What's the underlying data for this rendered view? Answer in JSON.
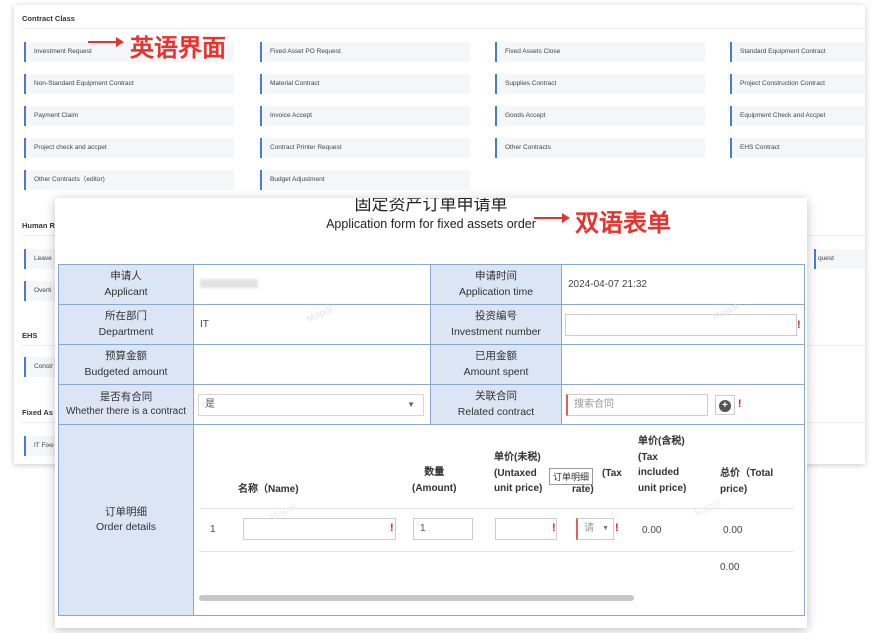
{
  "english_ui": {
    "annotation": "英语界面",
    "contract_class_title": "Contract Class",
    "contract_items": [
      "Investment Request",
      "Fixed Asset PO Request",
      "Fixed Assets Close",
      "Standard Equipment Contract",
      "Non-Standard Equipment Contract",
      "Material Contract",
      "Supplies Contract",
      "Project Construction Contract",
      "Payment Claim",
      "Invoice Accept",
      "Goods Accept",
      "Equipment Check and Accpet",
      "Project check and accpet",
      "Contract Printer Request",
      "Other Contracts",
      "EHS Contract",
      "Other Contracts（editor)",
      "Budget Adjustment"
    ],
    "human_title": "Human R",
    "human_items": [
      "Leave",
      "Overti"
    ],
    "human_right_item": "quest",
    "ehs_title": "EHS",
    "ehs_items": [
      "Constr"
    ],
    "fixed_title": "Fixed As",
    "fixed_items": [
      "IT Fixe"
    ]
  },
  "form": {
    "annotation": "双语表单",
    "title_cn": "固定资产订单申请单",
    "title_en": "Application form for fixed assets order",
    "watermark": "Mapol",
    "labels": {
      "applicant_cn": "申请人",
      "applicant_en": "Applicant",
      "app_time_cn": "申请时间",
      "app_time_en": "Application time",
      "dept_cn": "所在部门",
      "dept_en": "Department",
      "inv_no_cn": "投资编号",
      "inv_no_en": "Investment number",
      "budget_cn": "预算金额",
      "budget_en": "Budgeted amount",
      "spent_cn": "已用金额",
      "spent_en": "Amount spent",
      "has_contract_cn": "是否有合同",
      "has_contract_en": "Whether there is a contract",
      "related_cn": "关联合同",
      "related_en": "Related contract",
      "details_cn": "订单明细",
      "details_en": "Order details"
    },
    "values": {
      "application_time": "2024-04-07 21:32",
      "department": "IT",
      "has_contract": "是",
      "related_placeholder": "搜索合同"
    },
    "details": {
      "name_hdr": "名称（Name)",
      "qty_hdr_cn": "数量",
      "qty_hdr_en": "(Amount)",
      "untaxed_hdr_1": "单价(未税)",
      "untaxed_hdr_2": "(Untaxed",
      "untaxed_hdr_3": "unit price)",
      "tax_hdr_1": "(Tax",
      "tax_hdr_2": "rate)",
      "taxed_hdr_1": "单价(含税)",
      "taxed_hdr_2": "(Tax",
      "taxed_hdr_3": "included",
      "taxed_hdr_4": "unit price)",
      "total_hdr_1": "总价（Total",
      "total_hdr_2": "price)",
      "tooltip": "订单明细",
      "row_no": "1",
      "qty_value": "1",
      "tax_placeholder": "请",
      "taxed_value": "0.00",
      "total_value": "0.00",
      "sum_total": "0.00"
    }
  }
}
